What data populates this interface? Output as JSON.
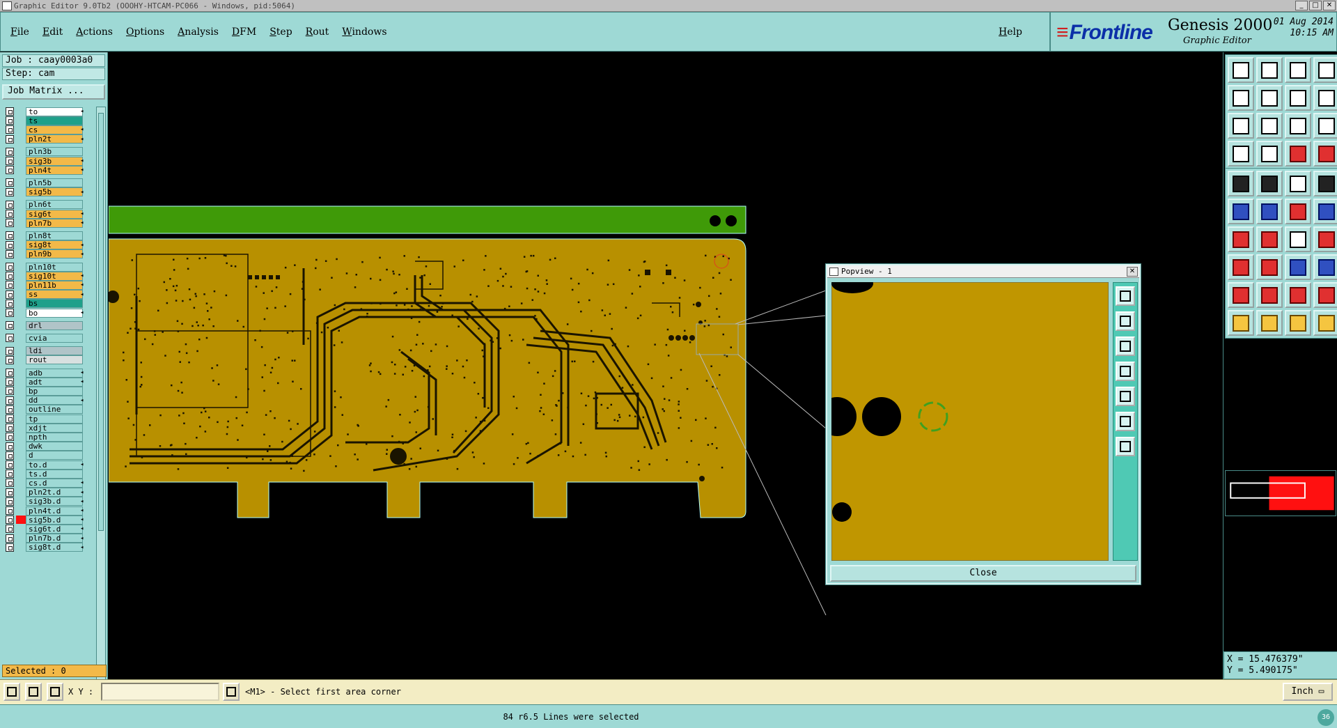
{
  "window": {
    "title": "Graphic Editor 9.0Tb2 (OOOHY-HTCAM-PC066 - Windows, pid:5064)"
  },
  "menu": {
    "items": [
      "File",
      "Edit",
      "Actions",
      "Options",
      "Analysis",
      "DFM",
      "Step",
      "Rout",
      "Windows"
    ],
    "help": "Help"
  },
  "brand": {
    "logo": "Frontline",
    "product": "Genesis 2000",
    "subtitle": "Graphic Editor",
    "date": "01 Aug 2014",
    "time": "10:15 AM"
  },
  "job": {
    "job_label": "Job : caay0003a0",
    "step_label": "Step: cam",
    "matrix_button": "Job Matrix ..."
  },
  "layers": [
    {
      "name": "to",
      "color": "#ffffff",
      "arrow": true
    },
    {
      "name": "ts",
      "color": "#1fa08a",
      "arrow": false
    },
    {
      "name": "cs",
      "color": "#f3b948",
      "arrow": true
    },
    {
      "name": "pln2t",
      "color": "#f3b948",
      "arrow": true
    },
    {
      "name": "pln3b",
      "color": "#9ed9d5",
      "arrow": false
    },
    {
      "name": "sig3b",
      "color": "#f3b948",
      "arrow": true
    },
    {
      "name": "pln4t",
      "color": "#f3b948",
      "arrow": true
    },
    {
      "name": "pln5b",
      "color": "#9ed9d5",
      "arrow": false
    },
    {
      "name": "sig5b",
      "color": "#f3b948",
      "arrow": true
    },
    {
      "name": "pln6t",
      "color": "#9ed9d5",
      "arrow": false
    },
    {
      "name": "sig6t",
      "color": "#f3b948",
      "arrow": true
    },
    {
      "name": "pln7b",
      "color": "#f3b948",
      "arrow": true
    },
    {
      "name": "pln8t",
      "color": "#9ed9d5",
      "arrow": false
    },
    {
      "name": "sig8t",
      "color": "#f3b948",
      "arrow": true
    },
    {
      "name": "pln9b",
      "color": "#f3b948",
      "arrow": true
    },
    {
      "name": "pln10t",
      "color": "#9ed9d5",
      "arrow": false
    },
    {
      "name": "sig10t",
      "color": "#f3b948",
      "arrow": true
    },
    {
      "name": "pln11b",
      "color": "#f3b948",
      "arrow": true
    },
    {
      "name": "ss",
      "color": "#f3b948",
      "arrow": true
    },
    {
      "name": "bs",
      "color": "#1fa08a",
      "arrow": false
    },
    {
      "name": "bo",
      "color": "#ffffff",
      "arrow": true
    },
    {
      "name": "drl",
      "color": "#b0c4c8",
      "arrow": false
    },
    {
      "name": "cvia",
      "color": "#9ed9d5",
      "arrow": false
    },
    {
      "name": "ldi",
      "color": "#b0c4c8",
      "arrow": false
    },
    {
      "name": "rout",
      "color": "#d8e0e0",
      "arrow": false
    },
    {
      "name": "adb",
      "color": "#9ed9d5",
      "arrow": true
    },
    {
      "name": "adt",
      "color": "#9ed9d5",
      "arrow": true
    },
    {
      "name": "bp",
      "color": "#9ed9d5",
      "arrow": false
    },
    {
      "name": "dd",
      "color": "#9ed9d5",
      "arrow": true
    },
    {
      "name": "outline",
      "color": "#9ed9d5",
      "arrow": false
    },
    {
      "name": "tp",
      "color": "#9ed9d5",
      "arrow": false
    },
    {
      "name": "xdjt",
      "color": "#9ed9d5",
      "arrow": false
    },
    {
      "name": "npth",
      "color": "#9ed9d5",
      "arrow": false
    },
    {
      "name": "dwk",
      "color": "#9ed9d5",
      "arrow": false
    },
    {
      "name": "d",
      "color": "#9ed9d5",
      "arrow": false
    },
    {
      "name": "to.d",
      "color": "#9ed9d5",
      "arrow": true
    },
    {
      "name": "ts.d",
      "color": "#9ed9d5",
      "arrow": false
    },
    {
      "name": "cs.d",
      "color": "#9ed9d5",
      "arrow": true
    },
    {
      "name": "pln2t.d",
      "color": "#9ed9d5",
      "arrow": true
    },
    {
      "name": "sig3b.d",
      "color": "#9ed9d5",
      "arrow": true
    },
    {
      "name": "pln4t.d",
      "color": "#9ed9d5",
      "arrow": true
    },
    {
      "name": "sig5b.d",
      "color": "#9ed9d5",
      "arrow": true
    },
    {
      "name": "sig6t.d",
      "color": "#9ed9d5",
      "arrow": true
    },
    {
      "name": "pln7b.d",
      "color": "#9ed9d5",
      "arrow": true
    },
    {
      "name": "sig8t.d",
      "color": "#9ed9d5",
      "arrow": true
    }
  ],
  "selected_count": "Selected : 0",
  "popview": {
    "title": "Popview - 1",
    "close_button": "Close"
  },
  "coords": {
    "x": "X = 15.476379\"",
    "y": "Y = 5.490175\""
  },
  "command": {
    "xy_label": "X Y :",
    "xy_value": "",
    "prompt": "<M1> - Select first area corner",
    "unit": "Inch"
  },
  "status": {
    "message": "84 r6.5 Lines were selected",
    "badge": "36"
  }
}
